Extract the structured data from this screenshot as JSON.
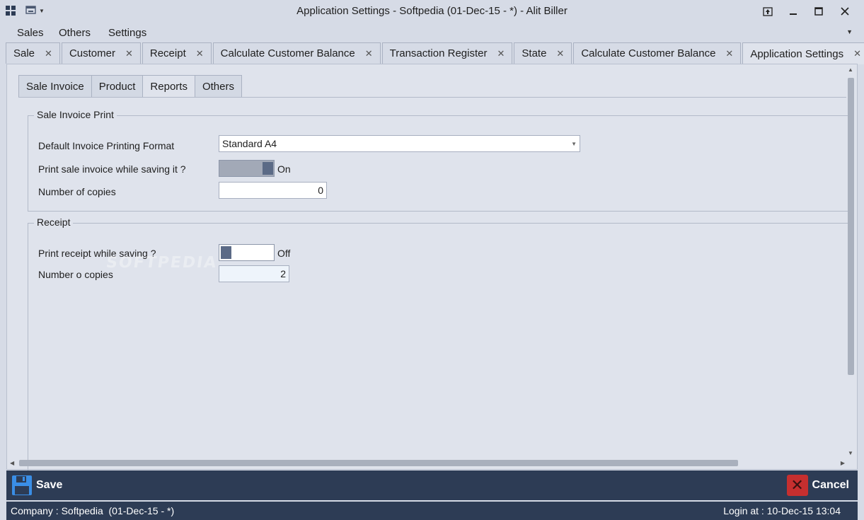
{
  "window": {
    "title": "Application Settings - Softpedia (01-Dec-15 - *) - Alit Biller",
    "icons": [
      "app-grid-icon",
      "quick-access-icon",
      "dropdown-icon"
    ],
    "controls": [
      "pin-icon",
      "minimize-icon",
      "maximize-icon",
      "close-icon"
    ]
  },
  "menu": {
    "items": [
      "Sales",
      "Others",
      "Settings"
    ]
  },
  "doc_tabs": [
    {
      "label": "Sale"
    },
    {
      "label": "Customer"
    },
    {
      "label": "Receipt"
    },
    {
      "label": "Calculate Customer Balance"
    },
    {
      "label": "Transaction Register"
    },
    {
      "label": "State"
    },
    {
      "label": "Calculate Customer Balance"
    },
    {
      "label": "Application Settings",
      "active": true
    }
  ],
  "inner_tabs": [
    {
      "label": "Sale Invoice"
    },
    {
      "label": "Product"
    },
    {
      "label": "Reports",
      "active": true
    },
    {
      "label": "Others"
    }
  ],
  "sale_invoice_print": {
    "title": "Sale Invoice Print",
    "format_label": "Default Invoice Printing Format",
    "format_value": "Standard A4",
    "print_label": "Print sale invoice while saving it ?",
    "print_state": "On",
    "copies_label": "Number of copies",
    "copies_value": "0"
  },
  "receipt": {
    "title": "Receipt",
    "print_label": "Print receipt while saving ?",
    "print_state": "Off",
    "copies_label": "Number o copies",
    "copies_value": "2"
  },
  "watermark": "SOFTPEDIA",
  "actions": {
    "save_label": "Save",
    "cancel_label": "Cancel"
  },
  "status": {
    "company": "Company : Softpedia  (01-Dec-15 - *)",
    "login": "Login at : 10-Dec-15 13:04"
  },
  "colors": {
    "background": "#d6dbe6",
    "panel": "#dfe3ec",
    "action_bar": "#2d3c55",
    "cancel_red": "#c62f2f",
    "save_blue": "#3a8ee6",
    "toggle_knob": "#5b6a86"
  }
}
